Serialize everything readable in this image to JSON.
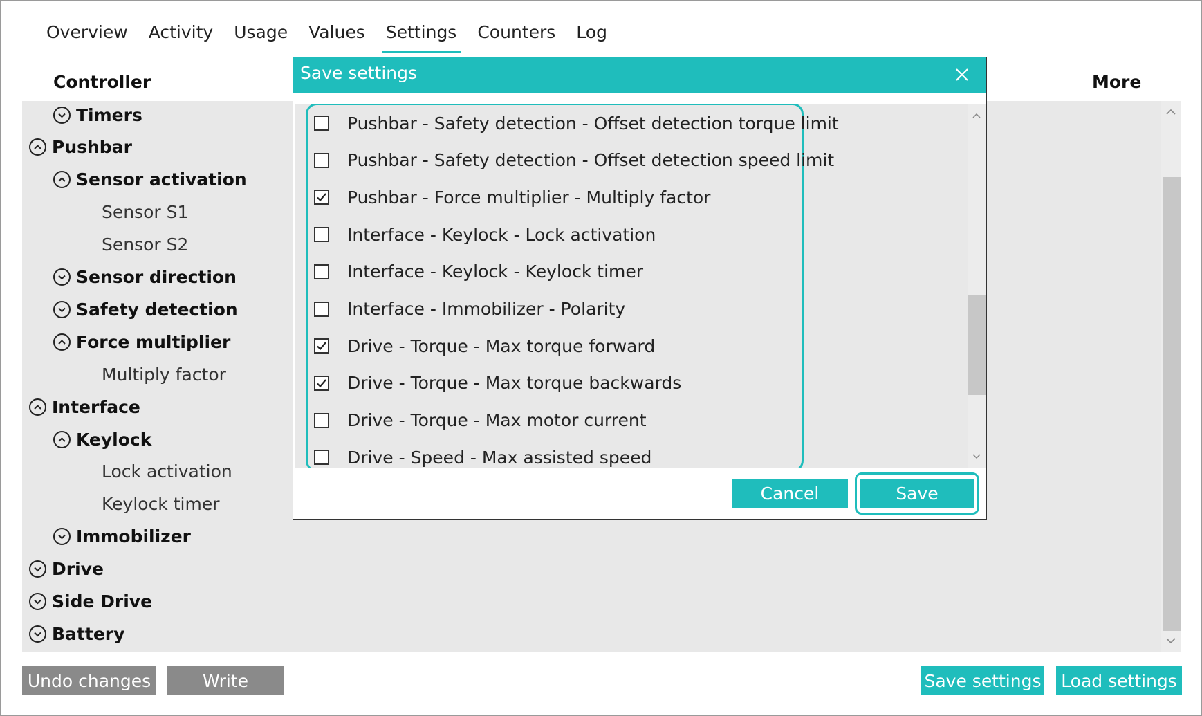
{
  "tabs": [
    "Overview",
    "Activity",
    "Usage",
    "Values",
    "Settings",
    "Counters",
    "Log"
  ],
  "active_tab": "Settings",
  "columns": {
    "left": "Controller",
    "right": "More"
  },
  "tree": [
    {
      "label": "Timers",
      "kind": "group",
      "state": "collapsed",
      "indent": 1
    },
    {
      "label": "Pushbar",
      "kind": "group",
      "state": "expanded",
      "indent": 0
    },
    {
      "label": "Sensor activation",
      "kind": "group",
      "state": "expanded",
      "indent": 1
    },
    {
      "label": "Sensor S1",
      "kind": "leaf",
      "indent": 2
    },
    {
      "label": "Sensor S2",
      "kind": "leaf",
      "indent": 2
    },
    {
      "label": "Sensor direction",
      "kind": "group",
      "state": "collapsed",
      "indent": 1
    },
    {
      "label": "Safety detection",
      "kind": "group",
      "state": "collapsed",
      "indent": 1
    },
    {
      "label": "Force multiplier",
      "kind": "group",
      "state": "expanded",
      "indent": 1
    },
    {
      "label": "Multiply factor",
      "kind": "leaf",
      "indent": 2
    },
    {
      "label": "Interface",
      "kind": "group",
      "state": "expanded",
      "indent": 0
    },
    {
      "label": "Keylock",
      "kind": "group",
      "state": "expanded",
      "indent": 1
    },
    {
      "label": "Lock activation",
      "kind": "leaf",
      "indent": 2
    },
    {
      "label": "Keylock timer",
      "kind": "leaf",
      "indent": 2
    },
    {
      "label": "Immobilizer",
      "kind": "group",
      "state": "collapsed",
      "indent": 1
    },
    {
      "label": "Drive",
      "kind": "group",
      "state": "collapsed",
      "indent": 0
    },
    {
      "label": "Side Drive",
      "kind": "group",
      "state": "collapsed",
      "indent": 0
    },
    {
      "label": "Battery",
      "kind": "group",
      "state": "collapsed",
      "indent": 0
    }
  ],
  "bottom_buttons": {
    "undo": "Undo changes",
    "write": "Write",
    "save_settings": "Save settings",
    "load_settings": "Load settings"
  },
  "modal": {
    "title": "Save settings",
    "items": [
      {
        "label": "Pushbar - Safety detection - Offset detection torque limit",
        "checked": false
      },
      {
        "label": "Pushbar - Safety detection - Offset detection speed limit",
        "checked": false
      },
      {
        "label": "Pushbar - Force multiplier - Multiply factor",
        "checked": true
      },
      {
        "label": "Interface - Keylock - Lock activation",
        "checked": false
      },
      {
        "label": "Interface - Keylock - Keylock timer",
        "checked": false
      },
      {
        "label": "Interface - Immobilizer - Polarity",
        "checked": false
      },
      {
        "label": "Drive - Torque - Max torque forward",
        "checked": true
      },
      {
        "label": "Drive - Torque - Max torque backwards",
        "checked": true
      },
      {
        "label": "Drive - Torque - Max motor current",
        "checked": false
      },
      {
        "label": "Drive - Speed - Max assisted speed",
        "checked": false
      }
    ],
    "cancel_label": "Cancel",
    "save_label": "Save"
  },
  "colors": {
    "accent": "#1fbdbc",
    "panel_bg": "#e8e8e8",
    "button_gray": "#8a8a8a"
  },
  "icons": {
    "expanded": "chevron-up-circle-icon",
    "collapsed": "chevron-down-circle-icon",
    "close": "close-icon",
    "check": "check-icon"
  }
}
